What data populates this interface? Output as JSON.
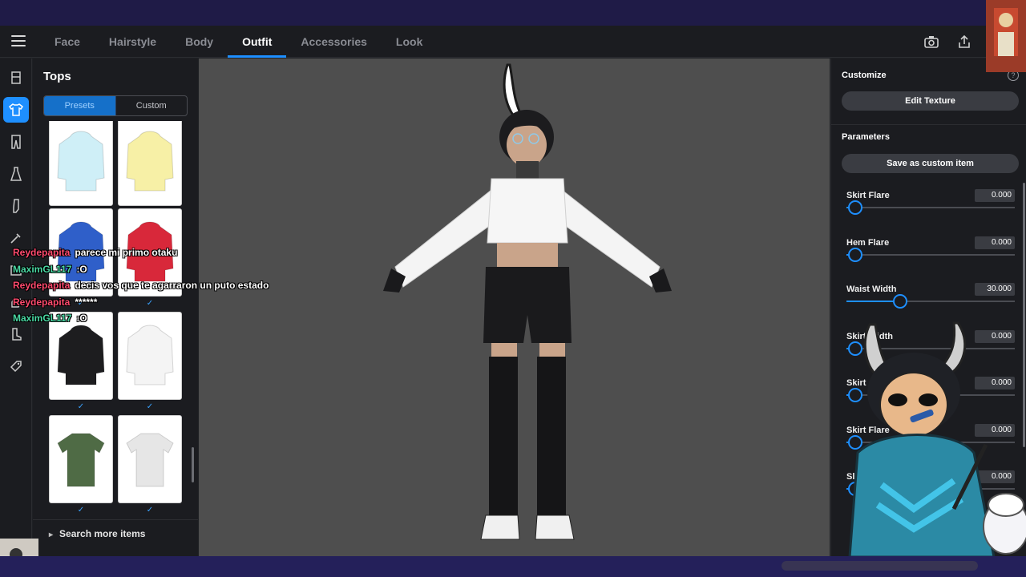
{
  "nav": {
    "tabs": [
      "Face",
      "Hairstyle",
      "Body",
      "Outfit",
      "Accessories",
      "Look"
    ],
    "active_tab": "Outfit",
    "icons": [
      "menu-icon",
      "camera-icon",
      "share-icon"
    ]
  },
  "sidebar_icons": [
    "hanger-icon",
    "shirt-icon",
    "pants-icon",
    "dress-icon",
    "sock-icon",
    "brush-icon",
    "shoe-icon",
    "glove-icon",
    "boot-icon",
    "tag-icon"
  ],
  "left_panel": {
    "title": "Tops",
    "segments": [
      "Presets",
      "Custom"
    ],
    "selected_segment": "Presets",
    "items": [
      {
        "color": "#cfeff7",
        "kind": "hoodie",
        "check": "✓"
      },
      {
        "color": "#f7f0a6",
        "kind": "hoodie",
        "check": "✓"
      },
      {
        "color": "#2f5fc9",
        "kind": "hoodie",
        "check": "✓"
      },
      {
        "color": "#d8283a",
        "kind": "hoodie",
        "check": "✓"
      },
      {
        "color": "#1d1d1f",
        "kind": "hoodie",
        "check": "✓"
      },
      {
        "color": "#f4f4f4",
        "kind": "hoodie",
        "check": "✓"
      },
      {
        "color": "#4f6b45",
        "kind": "tshirt",
        "check": "✓"
      },
      {
        "color": "#e6e6e6",
        "kind": "tshirt",
        "check": "✓"
      }
    ],
    "search_more": "Search more items"
  },
  "right_panel": {
    "customize_title": "Customize",
    "edit_texture": "Edit Texture",
    "parameters_title": "Parameters",
    "save_custom": "Save as custom item",
    "params": [
      {
        "label": "Skirt Flare",
        "value": "0.000",
        "fraction": 0.05
      },
      {
        "label": "Hem Flare",
        "value": "0.000",
        "fraction": 0.05
      },
      {
        "label": "Waist Width",
        "value": "30.000",
        "fraction": 0.32
      },
      {
        "label": "Skirt Width",
        "value": "0.000",
        "fraction": 0.05
      },
      {
        "label": "Skirt",
        "value": "0.000",
        "fraction": 0.05
      },
      {
        "label": "Skirt Flare",
        "value": "0.000",
        "fraction": 0.05
      },
      {
        "label": "Sl",
        "value": "0.000",
        "fraction": 0.05
      }
    ]
  },
  "chat": [
    {
      "user": "Reydepapita",
      "user_color": "#ff4a6e",
      "message": "parece mi primo otaku"
    },
    {
      "user": "MaximGL117",
      "user_color": "#4ad9a4",
      "message": ":O"
    },
    {
      "user": "Reydepapita",
      "user_color": "#ff4a6e",
      "message": "decis vos que te agarraron un puto estado"
    },
    {
      "user": "Reydepapita",
      "user_color": "#ff4a6e",
      "message": "******"
    },
    {
      "user": "MaximGL117",
      "user_color": "#4ad9a4",
      "message": ":O"
    }
  ],
  "colors": {
    "accent": "#1e8fff",
    "panel": "#1b1c20",
    "viewport": "#4e4e4e"
  }
}
